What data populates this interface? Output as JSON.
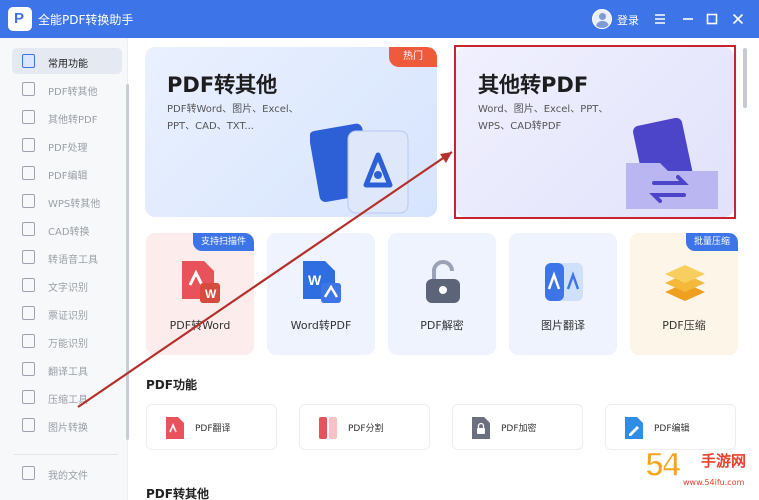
{
  "window": {
    "title": "全能PDF转换助手",
    "logo_letter": "P",
    "login_label": "登录",
    "menu_icon": "menu-icon",
    "minimize_icon": "minimize-icon",
    "maximize_icon": "maximize-icon",
    "close_icon": "close-icon"
  },
  "sidebar": {
    "items": [
      {
        "label": "常用功能",
        "active": true
      },
      {
        "label": "PDF转其他"
      },
      {
        "label": "其他转PDF"
      },
      {
        "label": "PDF处理"
      },
      {
        "label": "PDF编辑"
      },
      {
        "label": "WPS转其他"
      },
      {
        "label": "CAD转换"
      },
      {
        "label": "转语音工具"
      },
      {
        "label": "文字识别"
      },
      {
        "label": "票证识别"
      },
      {
        "label": "万能识别"
      },
      {
        "label": "翻译工具"
      },
      {
        "label": "压缩工具"
      },
      {
        "label": "图片转换"
      }
    ],
    "my_files": "我的文件"
  },
  "main": {
    "big_cards": [
      {
        "title": "PDF转其他",
        "desc": "PDF转Word、图片、Excel、PPT、CAD、TXT...",
        "badge": "热门"
      },
      {
        "title": "其他转PDF",
        "desc": "Word、图片、Excel、PPT、WPS、CAD转PDF"
      }
    ],
    "tools": [
      {
        "label": "PDF转Word",
        "badge": "支持扫描件",
        "icon": "pdf-to-word-icon"
      },
      {
        "label": "Word转PDF",
        "icon": "word-to-pdf-icon"
      },
      {
        "label": "PDF解密",
        "icon": "unlock-icon"
      },
      {
        "label": "图片翻译",
        "icon": "image-translate-icon"
      },
      {
        "label": "PDF压缩",
        "badge": "批量压缩",
        "icon": "compress-layers-icon"
      }
    ],
    "section_pdf_functions": "PDF功能",
    "functions": [
      {
        "label": "PDF翻译",
        "icon": "pdf-translate-icon",
        "color": "#e9525a"
      },
      {
        "label": "PDF分割",
        "icon": "pdf-split-icon",
        "color": "#e9525a"
      },
      {
        "label": "PDF加密",
        "icon": "pdf-lock-icon",
        "color": "#6b6f80"
      },
      {
        "label": "PDF编辑",
        "icon": "pdf-edit-icon",
        "color": "#2f8de4"
      }
    ],
    "section_pdf_to_other": "PDF转其他"
  },
  "watermark": {
    "number": "54",
    "text": "手游网",
    "url": "www.54ifu.com"
  },
  "colors": {
    "brand": "#3d74e8",
    "hot": "#f05a3c",
    "highlight_box": "#c8232f",
    "arrow": "#b5302c"
  }
}
